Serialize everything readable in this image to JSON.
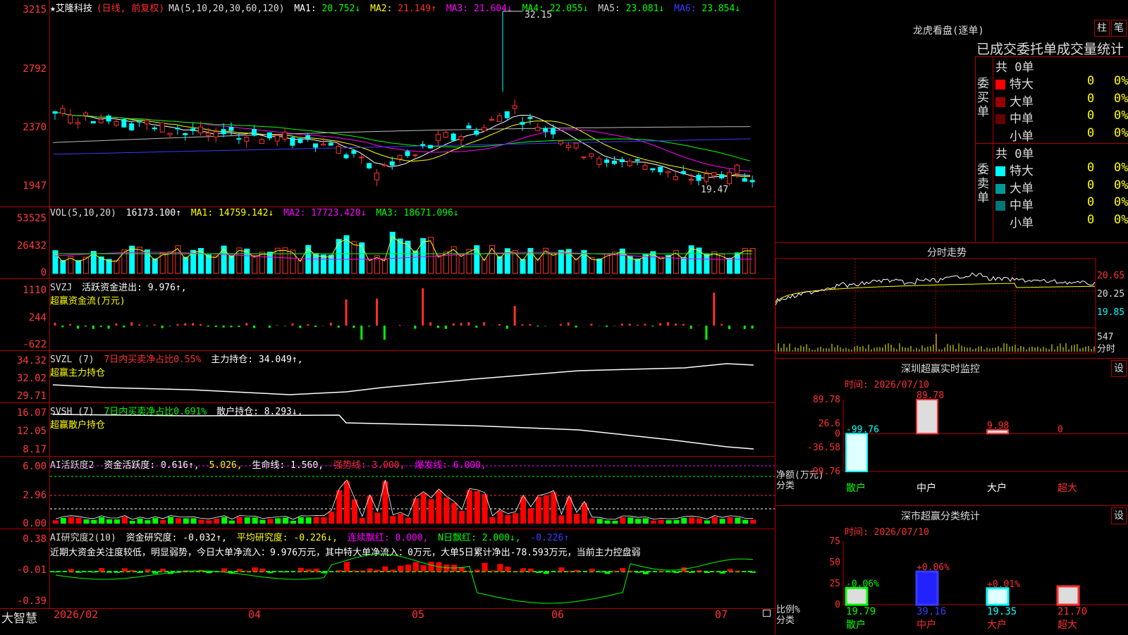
{
  "kline": {
    "title": "艾隆科技",
    "mode": "(日线, 前复权)",
    "ma_spec": "MA(5,10,20,30,60,120)",
    "ma": [
      {
        "label": "MA1:",
        "value": "20.752↓",
        "color": "#ffffff"
      },
      {
        "label": "MA2:",
        "value": "21.149↑",
        "color": "#ffff00"
      },
      {
        "label": "MA3:",
        "value": "21.604↓",
        "color": "#ff00ff"
      },
      {
        "label": "MA4:",
        "value": "22.055↓",
        "color": "#00ff00"
      },
      {
        "label": "MA5:",
        "value": "23.081↓",
        "color": "#cccccc"
      },
      {
        "label": "MA6:",
        "value": "23.854↓",
        "color": "#3b3bff"
      }
    ],
    "y_labels": [
      "3215",
      "2792",
      "2370",
      "1947"
    ],
    "high_label": "32.15",
    "low_label": "19.47"
  },
  "vol": {
    "title": "VOL(5,10,20)",
    "value": "16173.100↑",
    "ma1": "MA1: 14759.142↓",
    "ma2": "MA2: 17723.420↓",
    "ma3": "MA3: 18671.096↓",
    "y_labels": [
      "53525",
      "26432",
      "0"
    ]
  },
  "svzj": {
    "title": "SVZJ",
    "line1": "活跃资金进出: 9.976↑,",
    "line2": "超赢资金流(万元)",
    "y_labels": [
      "1110",
      "244",
      "-622"
    ]
  },
  "svzl": {
    "title": "SVZL (7)",
    "ratio": "7日内买卖净占比0.55%",
    "pos": "主力持仓: 34.049↑,",
    "line2": "超赢主力持仓",
    "y_labels": [
      "34.32",
      "32.02",
      "29.71"
    ]
  },
  "svsh": {
    "title": "SVSH (7)",
    "ratio": "7日内买卖净占比0.691%",
    "pos": "散户持仓: 8.293↓,",
    "line2": "超赢散户持仓",
    "y_labels": [
      "16.07",
      "12.05",
      "8.17"
    ]
  },
  "ai1": {
    "title": "AI活跃度2",
    "v1": "资金活跃度: 0.616↑,",
    "v2": "5.026,",
    "v3": "生命线: 1.560,",
    "v4": "强势线: 3.000,",
    "v5": "爆发线: 6.000,",
    "y_labels": [
      "6.00",
      "2.96",
      "0.00"
    ]
  },
  "ai2": {
    "title": "AI研究度2(10)",
    "v1": "资金研究度: -0.032↑,",
    "v2": "平均研究度: -0.226↓,",
    "v3": "连续飘红: 0.000,",
    "v4": "N日飘红: 2.000↓,",
    "v5": "-0.226↑",
    "desc": "近期大资金关注度较低，明显弱势，今日大单净流入：9.976万元，其中特大单净流入：0万元，大单5日累计净出-78.593万元，当前主力控盘弱",
    "y_labels": [
      "0.38",
      "-0.01",
      "-0.39"
    ]
  },
  "footer": {
    "brand": "大智慧",
    "dates": [
      "2026/02",
      "04",
      "05",
      "06",
      "07"
    ]
  },
  "lhb": {
    "title": "龙虎看盘(逐单)",
    "btn1": "柱",
    "btn2": "笔",
    "subtitle": "已成交委托单成交量统计",
    "buy_total": "共 0单",
    "sell_total": "共 0单",
    "buy_label": [
      "委",
      "买",
      "单"
    ],
    "sell_label": [
      "委",
      "卖",
      "单"
    ],
    "rows": [
      {
        "name": "特大",
        "count": "0",
        "pct": "0%"
      },
      {
        "name": "大单",
        "count": "0",
        "pct": "0%"
      },
      {
        "name": "中单",
        "count": "0",
        "pct": "0%"
      },
      {
        "name": "小单",
        "count": "0",
        "pct": "0%"
      }
    ],
    "buy_colors": [
      "#ff0000",
      "#990000",
      "#660000",
      ""
    ],
    "sell_colors": [
      "#00ffff",
      "#009999",
      "#007777",
      ""
    ]
  },
  "fenshi": {
    "title": "分时走势",
    "y_labels": [
      "20.65",
      "20.25",
      "19.85"
    ],
    "vol_label": "547",
    "vol_unit": "分时"
  },
  "monitor": {
    "title": "深圳超赢实时监控",
    "btn": "设",
    "time": "时间: 2026/07/10",
    "y_labels": [
      "89.78",
      "26.6",
      "0",
      "-36.58",
      "-99.76"
    ],
    "unit1": "净额(万元)",
    "unit2": "分类",
    "chart_data": {
      "type": "bar",
      "categories": [
        "散户",
        "中户",
        "大户",
        "超大"
      ],
      "values": [
        -99.76,
        89.78,
        9.98,
        0
      ],
      "labels": [
        "-99.76",
        "89.78",
        "9.98",
        "0"
      ],
      "ylim": [
        -99.76,
        89.78
      ]
    }
  },
  "classify": {
    "title": "深市超赢分类统计",
    "btn": "设",
    "time": "时间: 2026/07/10",
    "y_labels": [
      "75",
      "50",
      "25",
      "0"
    ],
    "unit1": "比例%",
    "unit2": "分类",
    "chart_data": {
      "type": "bar",
      "categories": [
        "散户",
        "中户",
        "大户",
        "超大"
      ],
      "values": [
        19.79,
        39.16,
        19.35,
        21.7
      ],
      "deltas": [
        "-0.06%",
        "+0.06%",
        "+0.01%",
        ""
      ],
      "ylim": [
        0,
        75
      ]
    }
  }
}
